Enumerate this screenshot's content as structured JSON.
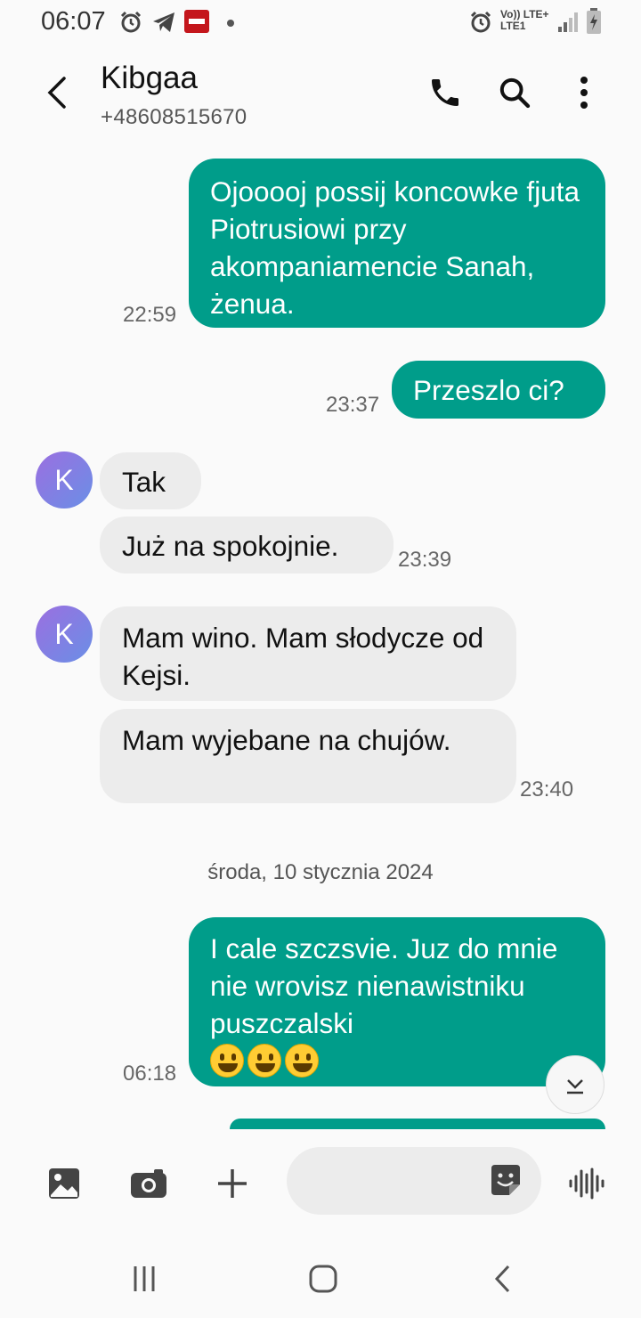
{
  "status_bar": {
    "time": "06:07",
    "network_label": "Vo)) LTE+",
    "network_sub": "LTE1",
    "icons": [
      "alarm-icon",
      "telegram-icon",
      "app-badge-icon",
      "dot-icon",
      "alarm-icon",
      "signal-icon",
      "battery-icon"
    ]
  },
  "header": {
    "contact_name": "Kibgaa",
    "contact_number": "+48608515670",
    "icons": [
      "back-arrow-icon",
      "phone-icon",
      "search-icon",
      "more-vert-icon"
    ]
  },
  "messages": [
    {
      "direction": "out",
      "text": "Ojooooj possij koncowke fjuta Piotrusiowi przy akompaniamencie Sanah, żenua.",
      "time": "22:59"
    },
    {
      "direction": "out",
      "text": "Przeszlo ci?",
      "time": "23:37"
    },
    {
      "direction": "in",
      "avatar": "K",
      "text": "Tak"
    },
    {
      "direction": "in",
      "text": "Już na spokojnie.",
      "time": "23:39"
    },
    {
      "direction": "in",
      "avatar": "K",
      "text": "Mam wino. Mam słodycze od Kejsi."
    },
    {
      "direction": "in",
      "text": "Mam wyjebane na chujów.",
      "time": "23:40"
    },
    {
      "direction": "out",
      "text": "I cale szczsvie. Juz do mnie nie wrovisz nienawistniku puszczalski",
      "emoji_count": 3,
      "time": "06:18"
    }
  ],
  "date_separator": "środa, 10 stycznia 2024",
  "composer": {
    "placeholder": "",
    "icons": [
      "gallery-icon",
      "camera-icon",
      "plus-icon",
      "sticker-icon",
      "voice-icon"
    ]
  },
  "colors": {
    "outgoing": "#009d8a",
    "incoming": "#ececec",
    "background": "#fafafa"
  }
}
